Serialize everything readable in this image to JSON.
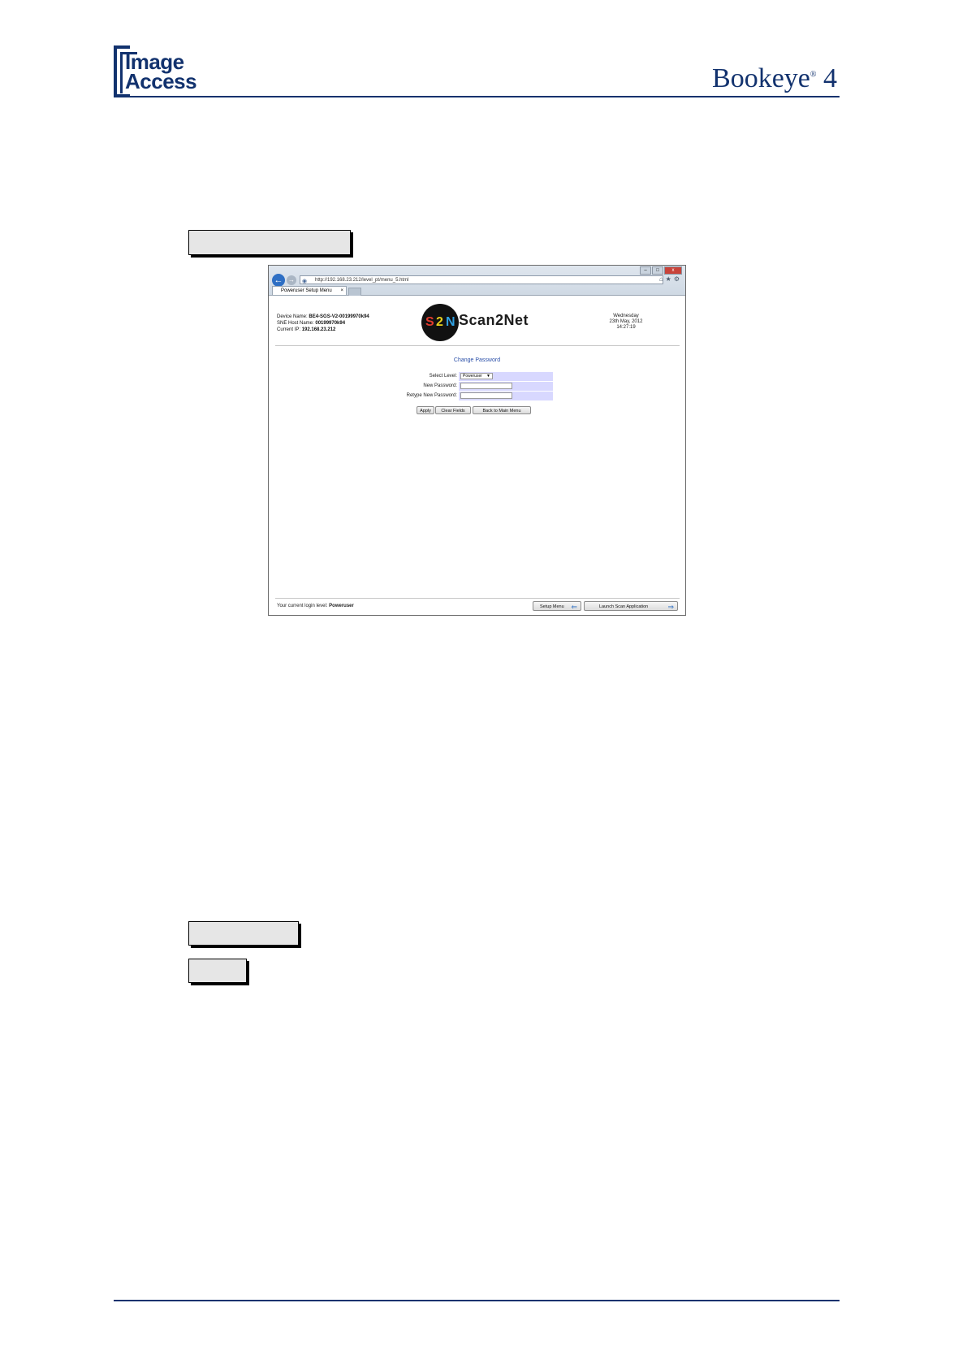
{
  "header": {
    "brand_left_line1": "Image",
    "brand_left_line2": "Access",
    "brand_right": "Bookeye",
    "brand_right_reg": "®",
    "brand_right_num": "4"
  },
  "browser": {
    "address": "http://192.168.23.212/level_pt/menu_5.html",
    "tab_title": "Poweruser Setup Menu",
    "tab_close": "×"
  },
  "device": {
    "name_label": "Device Name:",
    "name_value": "BE4-SGS-V2-00199970k94",
    "host_label": "SNE Host Name:",
    "host_value": "00199970k94",
    "ip_label": "Current IP:",
    "ip_value": "192.168.23.212"
  },
  "logo": {
    "s": "S",
    "two": "2",
    "n": "N",
    "word": "Scan2Net"
  },
  "date": {
    "weekday": "Wednesday",
    "day": "23th May, 2012",
    "time": "14:27:19"
  },
  "form": {
    "title": "Change Password",
    "level_label": "Select Level:",
    "level_value": "Poweruser",
    "new_pw_label": "New Password:",
    "retype_label": "Retype New Password:"
  },
  "buttons": {
    "apply": "Apply",
    "clear": "Clear Fields",
    "back": "Back to Main Menu"
  },
  "footer": {
    "level_text": "Your current login level:",
    "level_value": "Poweruser",
    "setup_menu": "Setup Menu",
    "launch": "Launch Scan Application"
  }
}
